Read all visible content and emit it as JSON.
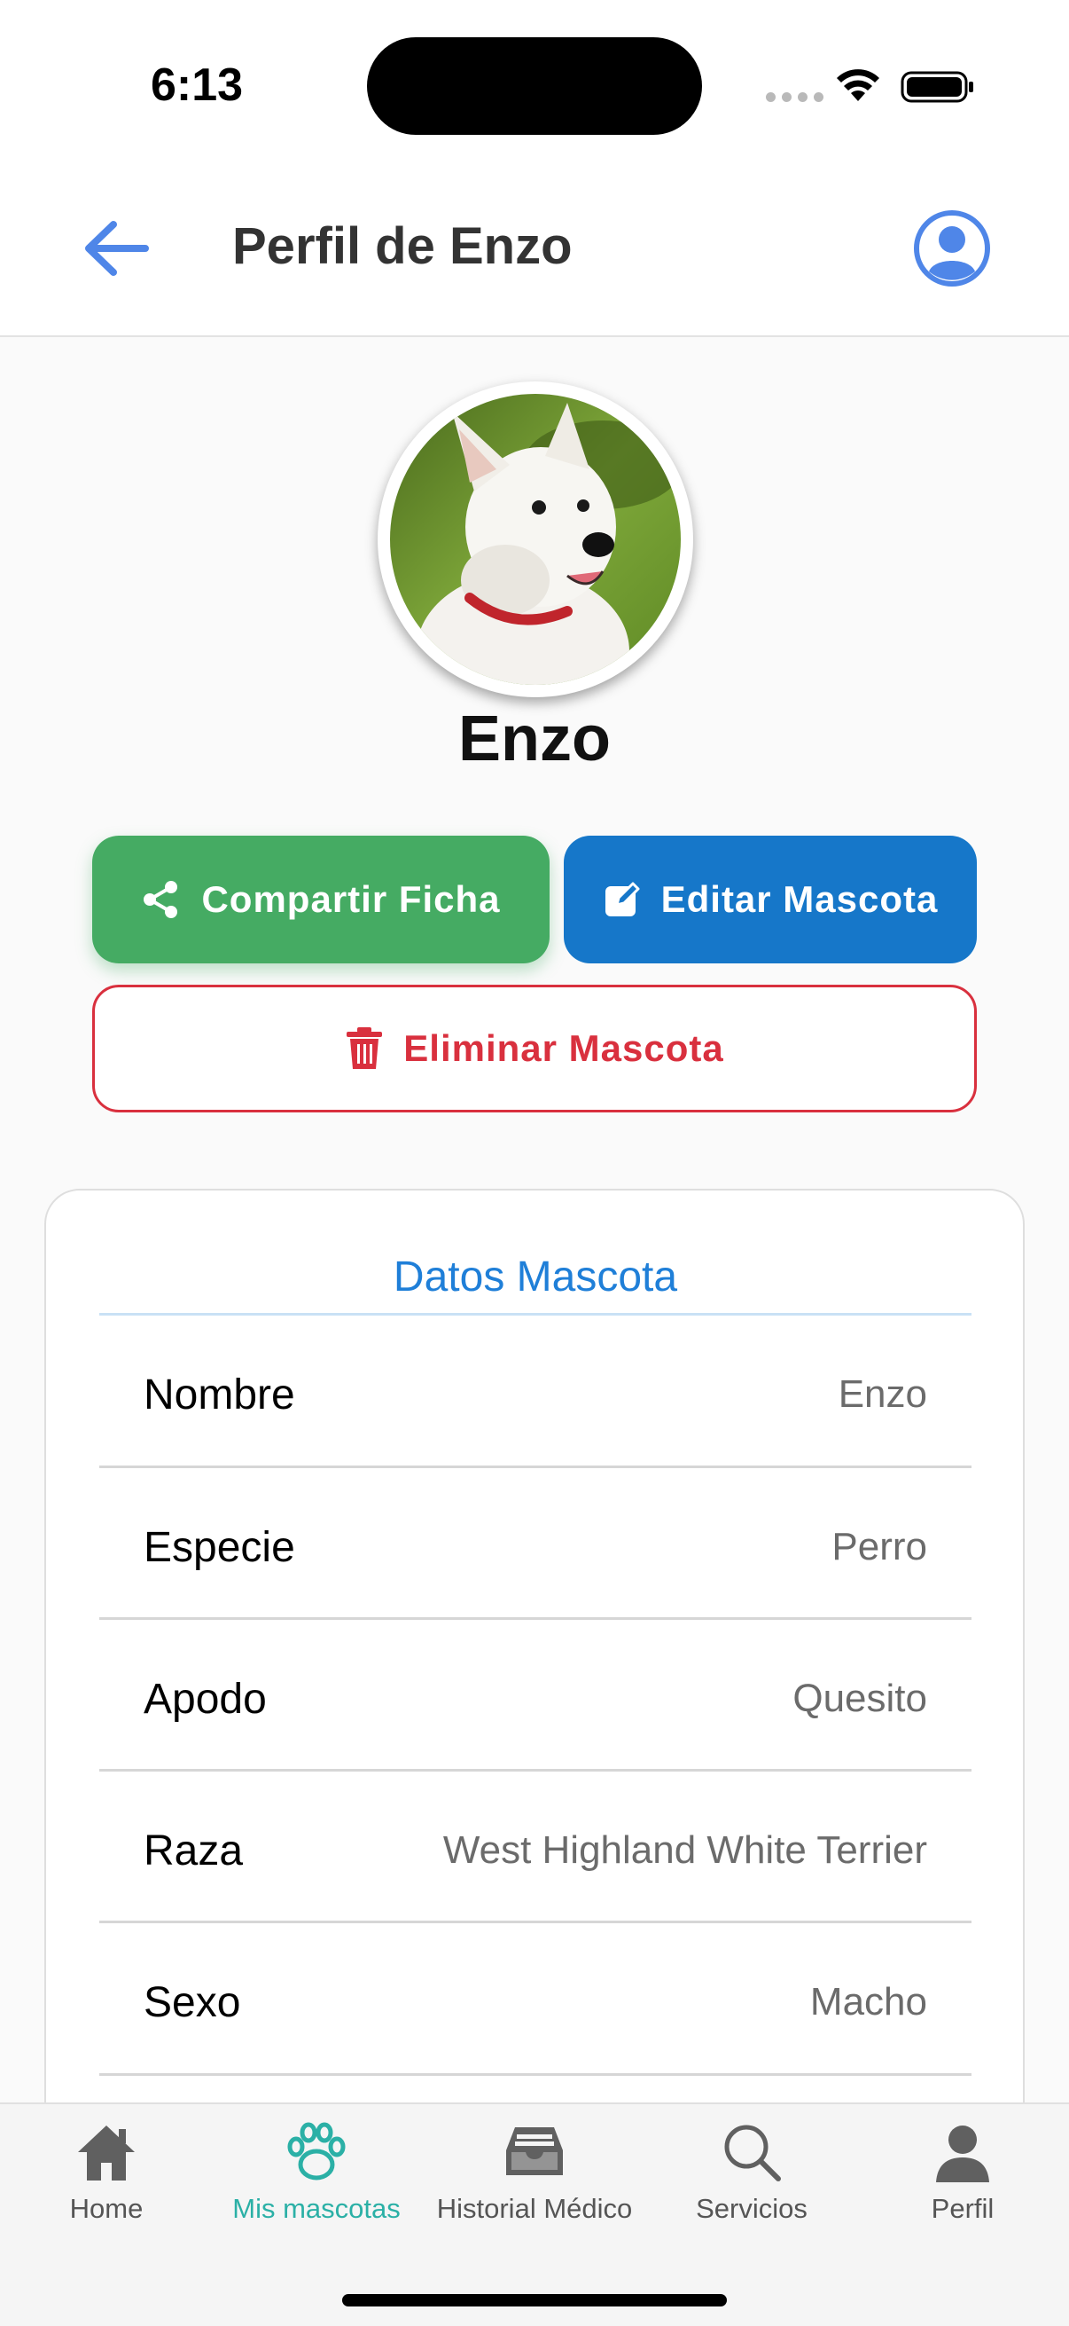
{
  "status_bar": {
    "time": "6:13"
  },
  "header": {
    "title": "Perfil de Enzo",
    "back_icon": "arrow-left-icon",
    "account_icon": "user-circle-icon",
    "accent_color": "#4f86e8"
  },
  "pet": {
    "name": "Enzo",
    "photo_description_icon": "pet-photo"
  },
  "actions": {
    "share_label": "Compartir Ficha",
    "edit_label": "Editar Mascota",
    "delete_label": "Eliminar Mascota",
    "share_color": "#45ab63",
    "edit_color": "#1677c9",
    "delete_color": "#d9303e"
  },
  "details": {
    "title": "Datos Mascota",
    "rows": [
      {
        "label": "Nombre",
        "value": "Enzo"
      },
      {
        "label": "Especie",
        "value": "Perro"
      },
      {
        "label": "Apodo",
        "value": "Quesito"
      },
      {
        "label": "Raza",
        "value": "West Highland White Terrier"
      },
      {
        "label": "Sexo",
        "value": "Macho"
      }
    ]
  },
  "tabbar": {
    "active_color": "#2bb0a6",
    "items": [
      {
        "label": "Home",
        "icon": "home-icon"
      },
      {
        "label": "Mis mascotas",
        "icon": "paw-icon"
      },
      {
        "label": "Historial Médico",
        "icon": "inbox-icon"
      },
      {
        "label": "Servicios",
        "icon": "search-icon"
      },
      {
        "label": "Perfil",
        "icon": "person-icon"
      }
    ]
  }
}
